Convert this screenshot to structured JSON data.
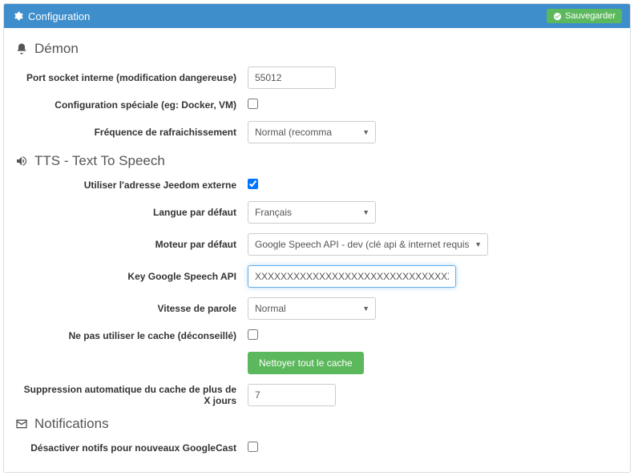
{
  "header": {
    "title": "Configuration",
    "save_label": "Sauvegarder"
  },
  "sections": {
    "demon": {
      "title": "Démon"
    },
    "tts": {
      "title": "TTS - Text To Speech"
    },
    "notifications": {
      "title": "Notifications"
    }
  },
  "demon": {
    "port_label": "Port socket interne (modification dangereuse)",
    "port_value": "55012",
    "special_config_label": "Configuration spéciale (eg: Docker, VM)",
    "refresh_label": "Fréquence de rafraichissement",
    "refresh_value": "Normal (recomma"
  },
  "tts": {
    "external_addr_label": "Utiliser l'adresse Jeedom externe",
    "external_addr_checked": true,
    "lang_label": "Langue par défaut",
    "lang_value": "Français",
    "engine_label": "Moteur par défaut",
    "engine_value": "Google Speech API - dev (clé api & internet requis)",
    "api_key_label": "Key Google Speech API",
    "api_key_value": "XXXXXXXXXXXXXXXXXXXXXXXXXXXXXXXXXXXXXXX",
    "speed_label": "Vitesse de parole",
    "speed_value": "Normal",
    "no_cache_label": "Ne pas utiliser le cache (déconseillé)",
    "clear_cache_label": "Nettoyer tout le cache",
    "auto_delete_label": "Suppression automatique du cache de plus de X jours",
    "auto_delete_value": "7"
  },
  "notifications": {
    "disable_label": "Désactiver notifs pour nouveaux GoogleCast"
  }
}
